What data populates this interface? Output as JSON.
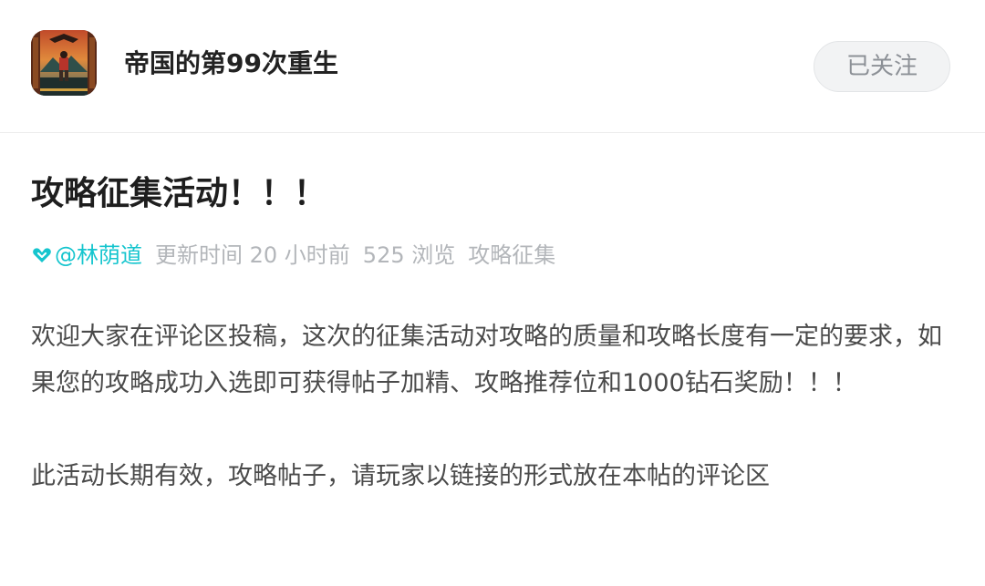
{
  "game": {
    "title": "帝国的第99次重生",
    "icon": "game-app-icon",
    "follow_label": "已关注"
  },
  "post": {
    "title": "攻略征集活动！！！",
    "author": "@林荫道",
    "updated": "更新时间 20 小时前",
    "views": "525 浏览",
    "category": "攻略征集",
    "paragraphs": [
      "欢迎大家在评论区投稿，这次的征集活动对攻略的质量和攻略长度有一定的要求，如果您的攻略成功入选即可获得帖子加精、攻略推荐位和1000钻石奖励！！！",
      "此活动长期有效，攻略帖子，请玩家以链接的形式放在本帖的评论区"
    ]
  },
  "colors": {
    "accent": "#15c5ce",
    "muted": "#b3b6ba",
    "text": "#4a4a4a"
  }
}
